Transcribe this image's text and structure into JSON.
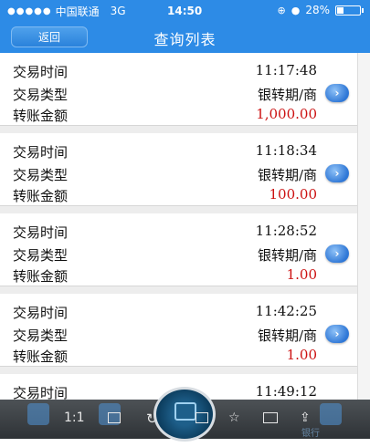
{
  "status_bar": {
    "carrier": "中国联通",
    "network": "3G",
    "time": "14:50",
    "battery": "28%",
    "battery_level": 0.28
  },
  "nav": {
    "back_label": "返回",
    "title": "查询列表"
  },
  "labels": {
    "time": "交易时间",
    "type": "交易类型",
    "amount": "转账金额"
  },
  "records": [
    {
      "time": "11:17:48",
      "type": "银转期/商",
      "amount": "1,000.00"
    },
    {
      "time": "11:18:34",
      "type": "银转期/商",
      "amount": "100.00"
    },
    {
      "time": "11:28:52",
      "type": "银转期/商",
      "amount": "1.00"
    },
    {
      "time": "11:42:25",
      "type": "银转期/商",
      "amount": "1.00"
    },
    {
      "time": "11:49:12"
    }
  ],
  "toolbar": {
    "zoom": "1:1",
    "faded_right": "银行"
  },
  "colors": {
    "header_blue": "#2d8be6",
    "amount_red": "#cc1111",
    "toolbar_dark": "#3a3f43"
  }
}
